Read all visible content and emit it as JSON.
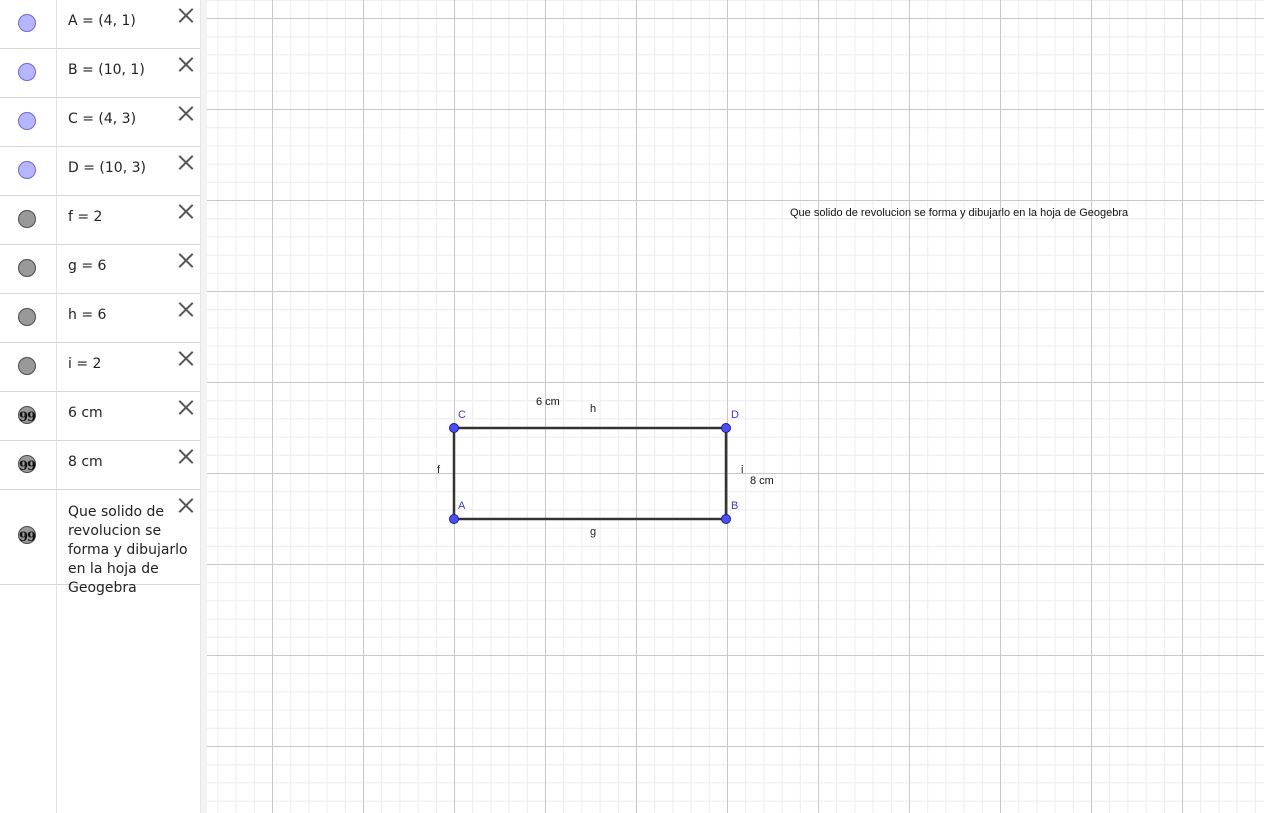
{
  "algebra": {
    "items": [
      {
        "label": "A = (4, 1)",
        "type": "point"
      },
      {
        "label": "B = (10, 1)",
        "type": "point"
      },
      {
        "label": "C = (4, 3)",
        "type": "point"
      },
      {
        "label": "D = (10, 3)",
        "type": "point"
      },
      {
        "label": "f = 2",
        "type": "num"
      },
      {
        "label": "g = 6",
        "type": "num"
      },
      {
        "label": "h = 6",
        "type": "num"
      },
      {
        "label": "i = 2",
        "type": "num"
      },
      {
        "label": "6 cm",
        "type": "text"
      },
      {
        "label": "8 cm",
        "type": "text"
      },
      {
        "label": "Que solido de revolucion se forma y dibujarlo en la hoja de Geogebra",
        "type": "text"
      }
    ],
    "text_icon_glyph": "99"
  },
  "graphics": {
    "points": {
      "A": {
        "label": "A",
        "x": 4,
        "y": 1
      },
      "B": {
        "label": "B",
        "x": 10,
        "y": 1
      },
      "C": {
        "label": "C",
        "x": 4,
        "y": 3
      },
      "D": {
        "label": "D",
        "x": 10,
        "y": 3
      }
    },
    "segment_labels": {
      "f": "f",
      "g": "g",
      "h": "h",
      "i": "i"
    },
    "texts": {
      "six_cm": "6 cm",
      "eight_cm": "8 cm",
      "question": "Que solido de revolucion se forma y dibujarlo en la hoja de Geogebra"
    },
    "colors": {
      "point_fill": "#4d4dff",
      "point_stroke": "#1a1a8c",
      "point_label": "#3c3ccc",
      "segment": "#333333",
      "grid_major": "#c8c8c8",
      "grid_minor": "#ececec"
    }
  }
}
